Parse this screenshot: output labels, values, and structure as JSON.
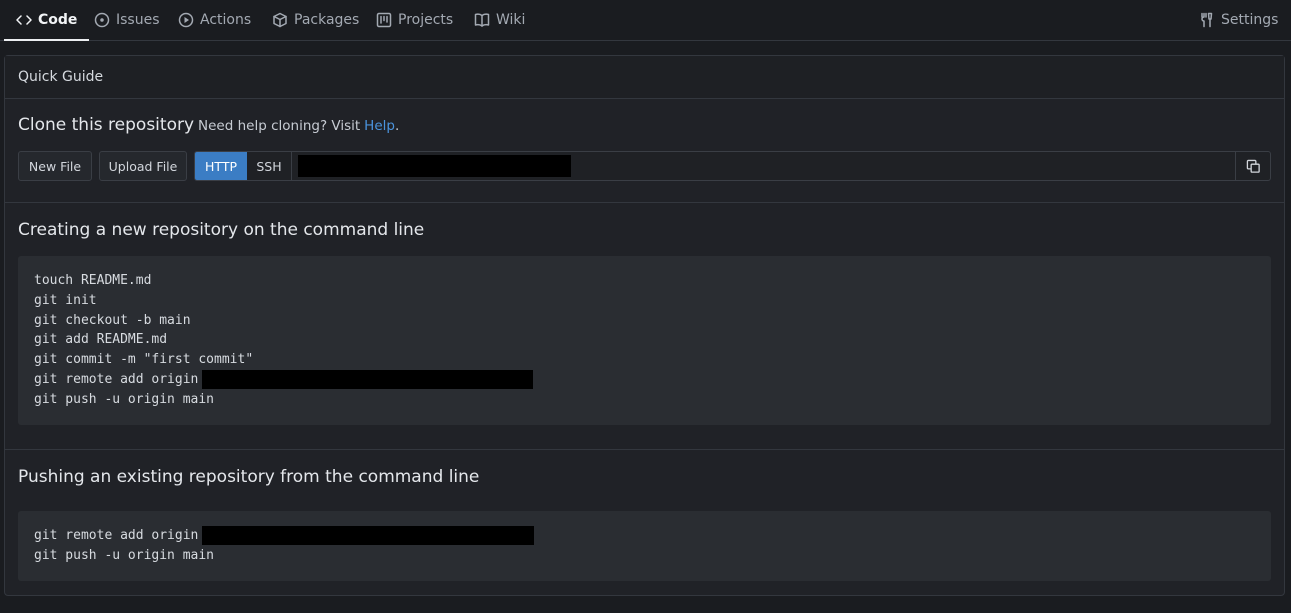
{
  "nav": {
    "tabs": [
      {
        "label": "Code",
        "icon": "code-icon",
        "active": true
      },
      {
        "label": "Issues",
        "icon": "issue-icon"
      },
      {
        "label": "Actions",
        "icon": "play-icon"
      },
      {
        "label": "Packages",
        "icon": "package-icon"
      },
      {
        "label": "Projects",
        "icon": "project-icon"
      },
      {
        "label": "Wiki",
        "icon": "book-icon"
      }
    ],
    "settings": {
      "label": "Settings",
      "icon": "tools-icon"
    }
  },
  "guide": {
    "header": "Quick Guide",
    "clone": {
      "title": "Clone this repository",
      "help_text": "Need help cloning? Visit",
      "help_link": "Help",
      "help_suffix": ".",
      "new_file_label": "New File",
      "upload_file_label": "Upload File",
      "protocols": [
        "HTTP",
        "SSH"
      ],
      "selected_protocol": "HTTP",
      "url_value": "",
      "copy_icon": "copy-icon"
    },
    "new_repo": {
      "title": "Creating a new repository on the command line",
      "lines": [
        "touch README.md",
        "git init",
        "git checkout -b main",
        "git add README.md",
        "git commit -m \"first commit\"",
        "git remote add origin",
        "git push -u origin main"
      ]
    },
    "existing_repo": {
      "title": "Pushing an existing repository from the command line",
      "lines": [
        "git remote add origin",
        "git push -u origin main"
      ]
    }
  },
  "colors": {
    "background": "#1a1c20",
    "panel": "#202227",
    "accent": "#3b7dc4",
    "link": "#4a94dd",
    "code_bg": "#2a2d32"
  }
}
